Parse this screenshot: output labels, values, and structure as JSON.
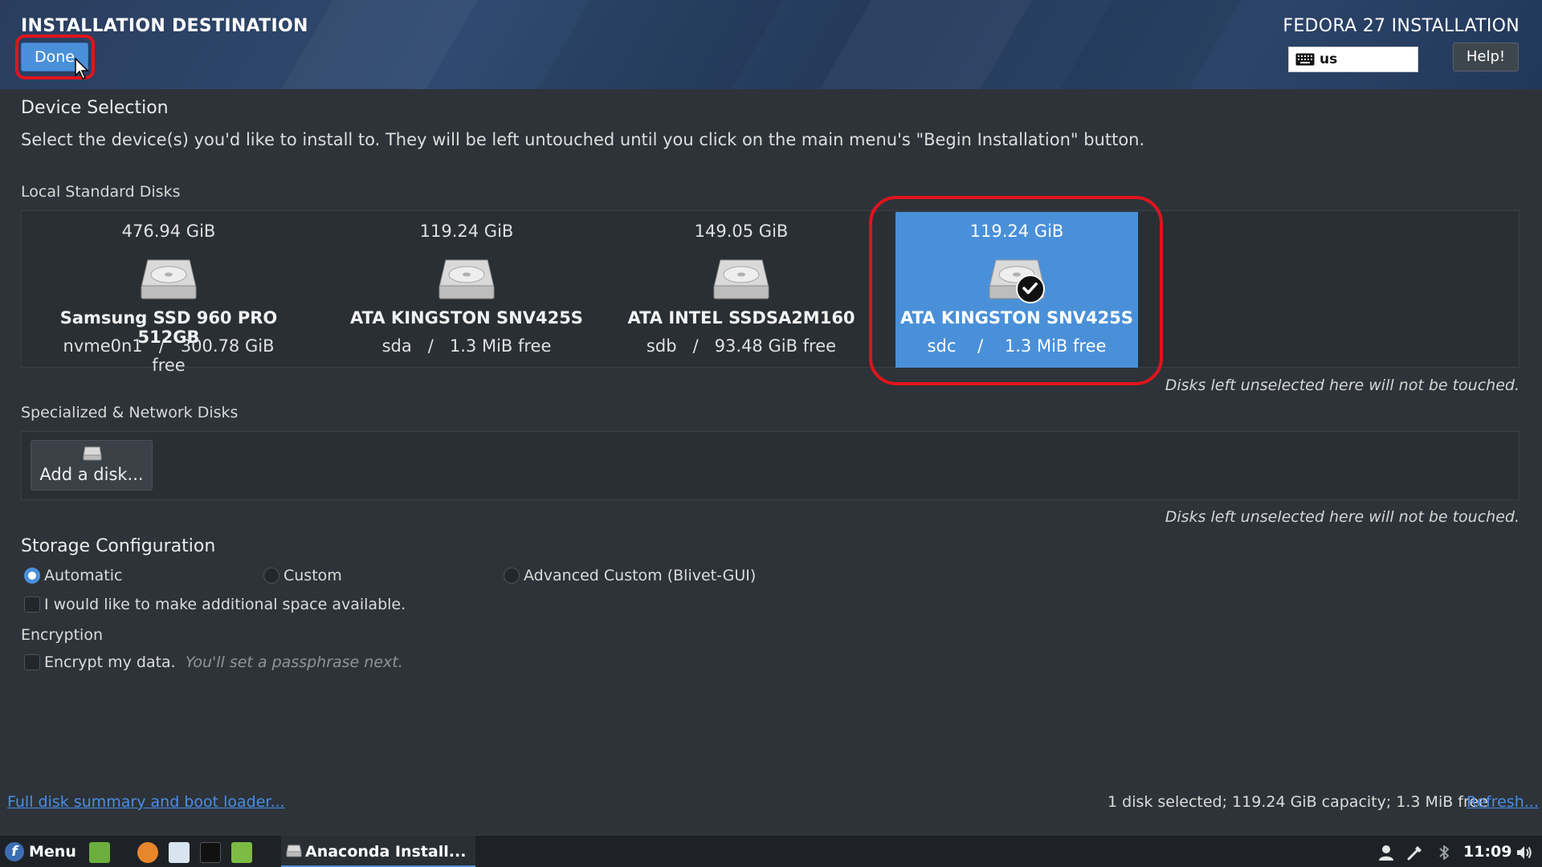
{
  "header": {
    "spoke_title": "INSTALLATION DESTINATION",
    "done_label": "Done",
    "product_title": "FEDORA 27 INSTALLATION",
    "keyboard_layout": "us",
    "help_label": "Help!"
  },
  "device_selection": {
    "title": "Device Selection",
    "description": "Select the device(s) you'd like to install to.  They will be left untouched until you click on the main menu's \"Begin Installation\" button."
  },
  "local_disks": {
    "title": "Local Standard Disks",
    "disks": [
      {
        "capacity": "476.94 GiB",
        "name": "Samsung SSD 960 PRO 512GB",
        "device": "nvme0n1",
        "sep": "/",
        "free": "300.78 GiB free",
        "selected": false
      },
      {
        "capacity": "119.24 GiB",
        "name": "ATA KINGSTON SNV425S",
        "device": "sda",
        "sep": "/",
        "free": "1.3 MiB free",
        "selected": false
      },
      {
        "capacity": "149.05 GiB",
        "name": "ATA INTEL SSDSA2M160",
        "device": "sdb",
        "sep": "/",
        "free": "93.48 GiB free",
        "selected": false
      },
      {
        "capacity": "119.24 GiB",
        "name": "ATA KINGSTON SNV425S",
        "device": "sdc",
        "sep": "/",
        "free": "1.3 MiB free",
        "selected": true
      }
    ],
    "note": "Disks left unselected here will not be touched."
  },
  "network_disks": {
    "title": "Specialized & Network Disks",
    "add_label": "Add a disk...",
    "note": "Disks left unselected here will not be touched."
  },
  "storage": {
    "title": "Storage Configuration",
    "options": [
      {
        "label": "Automatic",
        "checked": true
      },
      {
        "label": "Custom",
        "checked": false
      },
      {
        "label": "Advanced Custom (Blivet-GUI)",
        "checked": false
      }
    ],
    "reclaim_label": "I would like to make additional space available."
  },
  "encryption": {
    "title": "Encryption",
    "encrypt_label": "Encrypt my data.",
    "encrypt_hint": "You'll set a passphrase next."
  },
  "footer": {
    "summary_link": "Full disk summary and boot loader...",
    "status": "1 disk selected; 119.24 GiB capacity; 1.3 MiB free",
    "refresh_link": "Refresh..."
  },
  "taskbar": {
    "menu_label": "Menu",
    "task_label": "Anaconda Install...",
    "clock": "11:09"
  },
  "colors": {
    "accent": "#4a90d9",
    "highlight_ring": "#e0141d",
    "background": "#2d3338"
  },
  "icons": [
    "keyboard-icon",
    "hard-drive-icon",
    "checkmark-icon",
    "fedora-logo-icon",
    "user-icon",
    "network-icon",
    "bluetooth-icon",
    "volume-icon"
  ]
}
